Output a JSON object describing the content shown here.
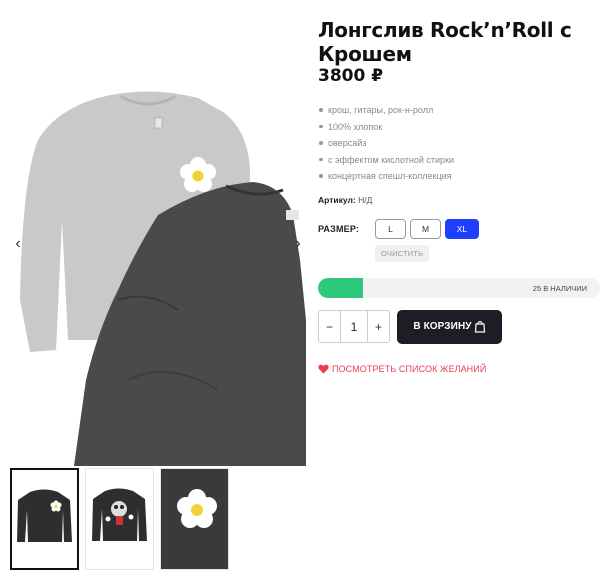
{
  "product": {
    "title": "Лонгслив Rock’n’Roll с Крошем",
    "price": "3800 ₽",
    "features": [
      "крош, гитары, рок-н-ролл",
      "100% хлопок",
      "оверсайз",
      "с эффектом кислотной стирки",
      "концертная спешл-коллекция"
    ],
    "sku_label": "Артикул:",
    "sku_value": "Н/Д"
  },
  "size": {
    "label": "РАЗМЕР:",
    "options": [
      "L",
      "M",
      "XL"
    ],
    "selected": "XL",
    "clear_label": "ОЧИСТИТЬ"
  },
  "stock": {
    "text": "25 В НАЛИЧИИ",
    "fill_fraction": 0.16,
    "color": "#2ec87a"
  },
  "cart": {
    "minus": "−",
    "quantity": "1",
    "plus": "+",
    "button_label": "В КОРЗИНУ"
  },
  "wishlist": {
    "label": "ПОСМОТРЕТЬ СПИСОК ЖЕЛАНИЙ",
    "color": "#ea3b53"
  },
  "gallery": {
    "prev_icon": "‹",
    "next_icon": "›",
    "thumbnails": [
      "dark-longsleeve-daisy",
      "dark-longsleeve-krosh-print",
      "daisy-closeup"
    ],
    "active_thumbnail": 0
  },
  "colors": {
    "accent": "#1f3fff",
    "dark": "#1d1d25"
  }
}
